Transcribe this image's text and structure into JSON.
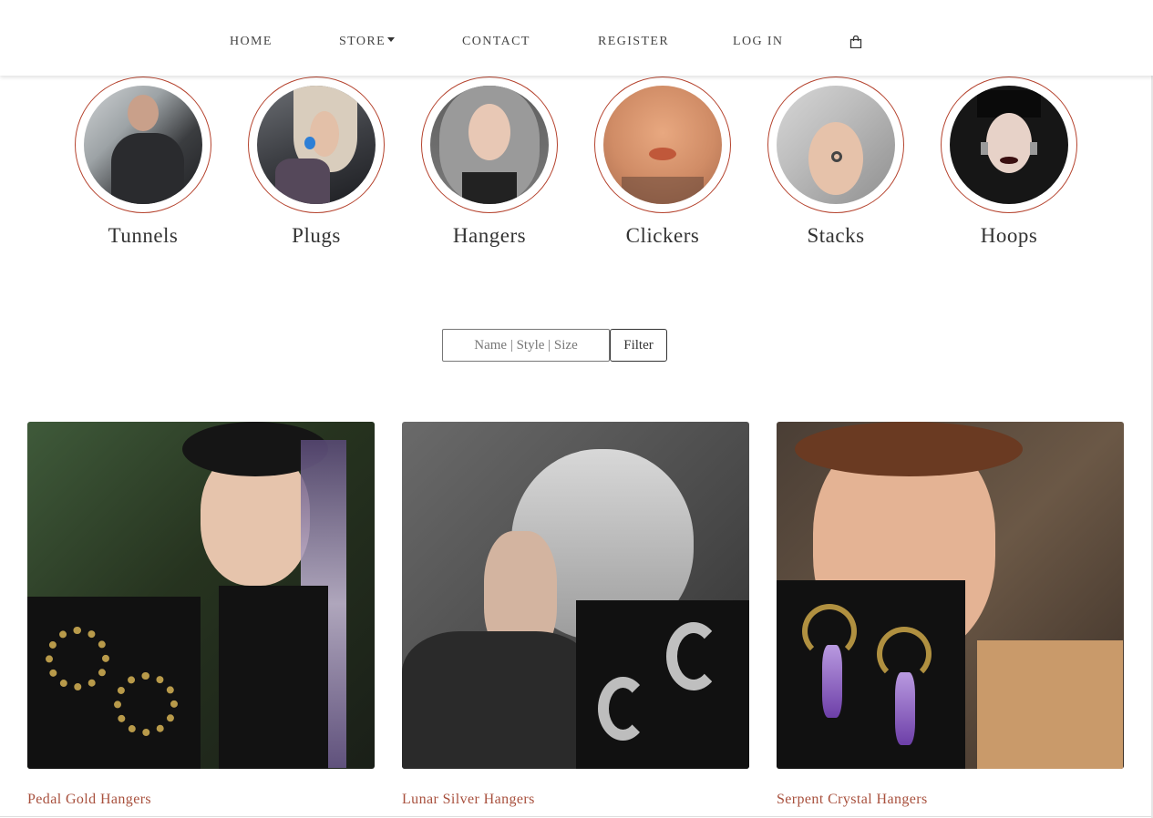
{
  "nav": {
    "home": "HOME",
    "store": "STORE",
    "contact": "CONTACT",
    "register": "REGISTER",
    "login": "LOG IN",
    "cart_icon": "shopping-bag-icon"
  },
  "categories": [
    {
      "label": "Tunnels"
    },
    {
      "label": "Plugs"
    },
    {
      "label": "Hangers"
    },
    {
      "label": "Clickers"
    },
    {
      "label": "Stacks"
    },
    {
      "label": "Hoops"
    }
  ],
  "filter": {
    "placeholder": "Name | Style | Size",
    "button": "Filter"
  },
  "products": [
    {
      "name": "Pedal Gold Hangers"
    },
    {
      "name": "Lunar Silver Hangers"
    },
    {
      "name": "Serpent Crystal Hangers"
    }
  ],
  "colors": {
    "accent": "#b5432e",
    "product_link": "#a8503d"
  }
}
